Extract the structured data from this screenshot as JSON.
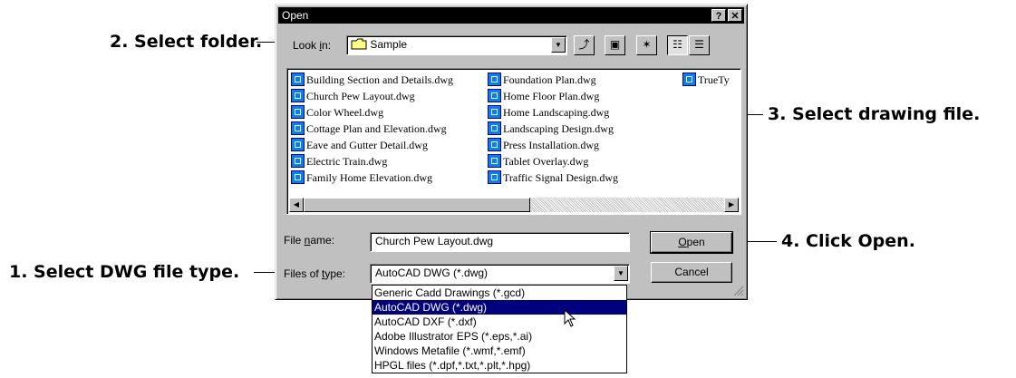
{
  "callouts": {
    "step1": "1. Select DWG file type.",
    "step2": "2. Select folder.",
    "step3": "3. Select drawing file.",
    "step4": "4. Click Open."
  },
  "dialog": {
    "title": "Open",
    "help_label": "?",
    "close_label": "✕",
    "look_in_label_pre": "Look ",
    "look_in_label_u": "i",
    "look_in_label_post": "n:",
    "look_in_value": "Sample",
    "files": {
      "col1": [
        "Building Section and Details.dwg",
        "Church Pew Layout.dwg",
        "Color Wheel.dwg",
        "Cottage Plan and Elevation.dwg",
        "Eave and Gutter Detail.dwg",
        "Electric Train.dwg",
        "Family Home Elevation.dwg"
      ],
      "col2": [
        "Foundation Plan.dwg",
        "Home Floor Plan.dwg",
        "Home Landscaping.dwg",
        "Landscaping Design.dwg",
        "Press Installation.dwg",
        "Tablet Overlay.dwg",
        "Traffic Signal Design.dwg"
      ],
      "col3": [
        "TrueTy"
      ]
    },
    "file_name_label_pre": "File ",
    "file_name_label_u": "n",
    "file_name_label_post": "ame:",
    "file_name_value": "Church Pew Layout.dwg",
    "files_of_type_label_pre": "Files of ",
    "files_of_type_label_u": "t",
    "files_of_type_label_post": "ype:",
    "files_of_type_value": "AutoCAD DWG (*.dwg)",
    "open_label_u": "O",
    "open_label_post": "pen",
    "cancel_label": "Cancel",
    "type_options": [
      "Generic Cadd Drawings (*.gcd)",
      "AutoCAD DWG (*.dwg)",
      "AutoCAD DXF (*.dxf)",
      "Adobe Illustrator EPS (*.eps,*.ai)",
      "Windows Metafile (*.wmf,*.emf)",
      "HPGL files (*.dpf,*.txt,*.plt,*.hpg)"
    ],
    "selected_type_index": 1
  },
  "icons": [
    "folder-icon",
    "up-folder-icon",
    "desktop-icon",
    "new-folder-icon",
    "list-view-icon",
    "details-view-icon",
    "dwg-file-icon",
    "mouse-pointer-icon"
  ]
}
